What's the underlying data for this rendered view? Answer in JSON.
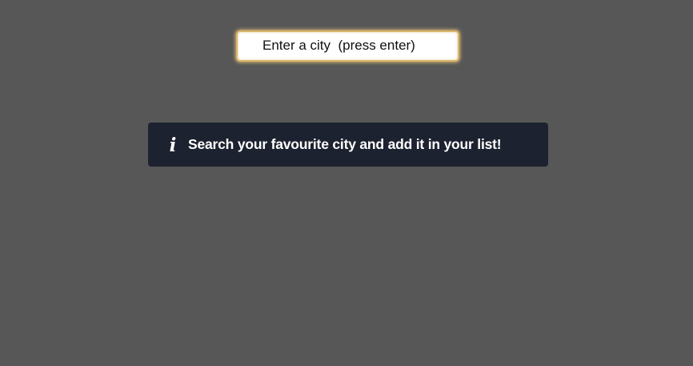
{
  "search": {
    "placeholder": "Enter a city  (press enter)",
    "value": ""
  },
  "info_banner": {
    "icon": "info-icon",
    "icon_glyph": "i",
    "message": "Search your favourite city and add it in your list!"
  },
  "colors": {
    "page_background": "#575757",
    "banner_background": "#1c222f",
    "input_glow": "#d9b56a"
  }
}
